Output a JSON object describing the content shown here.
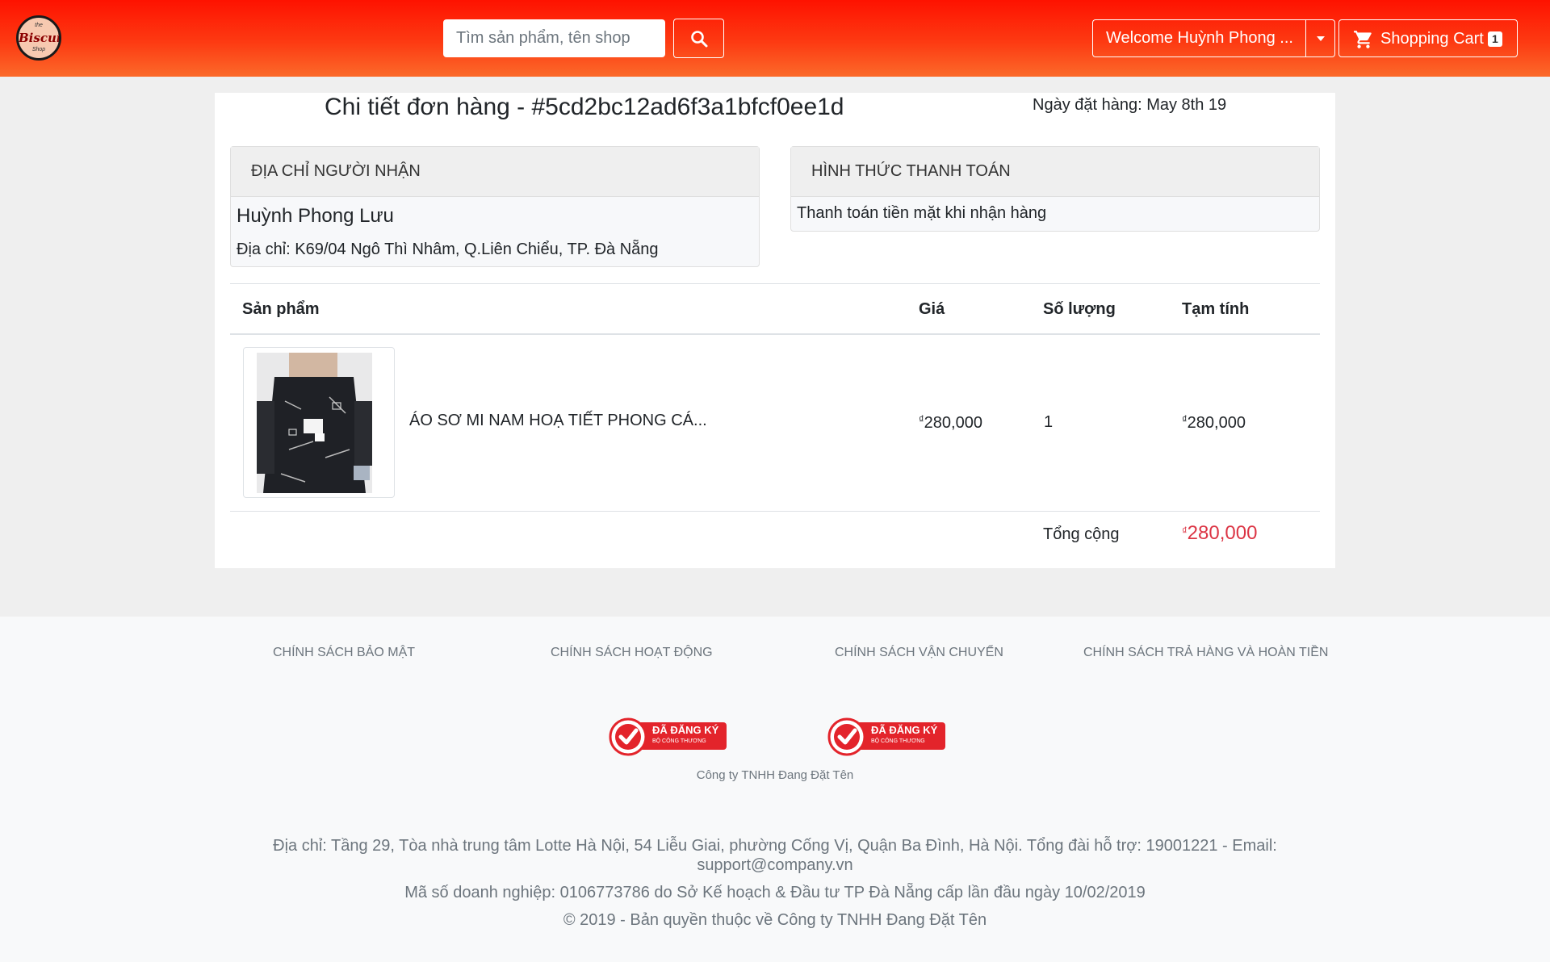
{
  "header": {
    "logo_top": "the",
    "logo_main": "Biscuit",
    "logo_bottom": "Shop",
    "search_placeholder": "Tìm sản phẩm, tên shop",
    "welcome_label": "Welcome Huỳnh Phong ...",
    "cart_label": "Shopping Cart",
    "cart_count": "1",
    "colors": {
      "header_top": "#fe1200",
      "header_bottom": "#fb6a2a"
    },
    "icons": {
      "search": "search-icon",
      "dropdown": "caret-down-icon",
      "cart": "cart-icon"
    }
  },
  "order": {
    "title": "Chi tiết đơn hàng - #5cd2bc12ad6f3a1bfcf0ee1d",
    "date": "Ngày đặt hàng: May 8th 19"
  },
  "address_panel": {
    "heading": "ĐỊA CHỈ NGƯỜI NHẬN",
    "name": "Huỳnh Phong Lưu",
    "address": "Địa chỉ: K69/04 Ngô Thì Nhâm, Q.Liên Chiểu, TP. Đà Nẵng"
  },
  "payment_panel": {
    "heading": "HÌNH THỨC THANH TOÁN",
    "method": "Thanh toán tiền mặt khi nhận hàng"
  },
  "table": {
    "headers": [
      "Sản phẩm",
      "Giá",
      "Số lượng",
      "Tạm tính"
    ],
    "rows": [
      {
        "product": "ÁO SƠ MI NAM HOẠ TIẾT PHONG CÁ...",
        "currency": "₫",
        "price": "280,000",
        "quantity": "1",
        "subtotal": "280,000"
      }
    ],
    "total_label": "Tổng cộng",
    "total_currency": "₫",
    "total_value": "280,000",
    "total_color": "#dc3545"
  },
  "footer": {
    "policies": [
      "CHÍNH SÁCH BẢO MẬT",
      "CHÍNH SÁCH HOẠT ĐỘNG",
      "CHÍNH SÁCH VẬN CHUYỂN",
      "CHÍNH SÁCH TRẢ HÀNG VÀ HOÀN TIỀN"
    ],
    "badge_text": "ĐÃ ĐĂNG KÝ",
    "badge_subtext": "BỘ CÔNG THƯƠNG",
    "company": "Công ty TNHH Đang Đặt Tên",
    "address_line": "Địa chỉ: Tầng 29, Tòa nhà trung tâm Lotte Hà Nội, 54 Liễu Giai, phường Cống Vị, Quận Ba Đình, Hà Nội. Tổng đài hỗ trợ: 19001221 - Email: support@company.vn",
    "business_line": "Mã số doanh nghiệp: 0106773786 do Sở Kế hoạch & Đầu tư TP Đà Nẵng cấp lần đầu ngày 10/02/2019",
    "copyright": "© 2019 - Bản quyền thuộc về Công ty TNHH Đang Đặt Tên"
  }
}
